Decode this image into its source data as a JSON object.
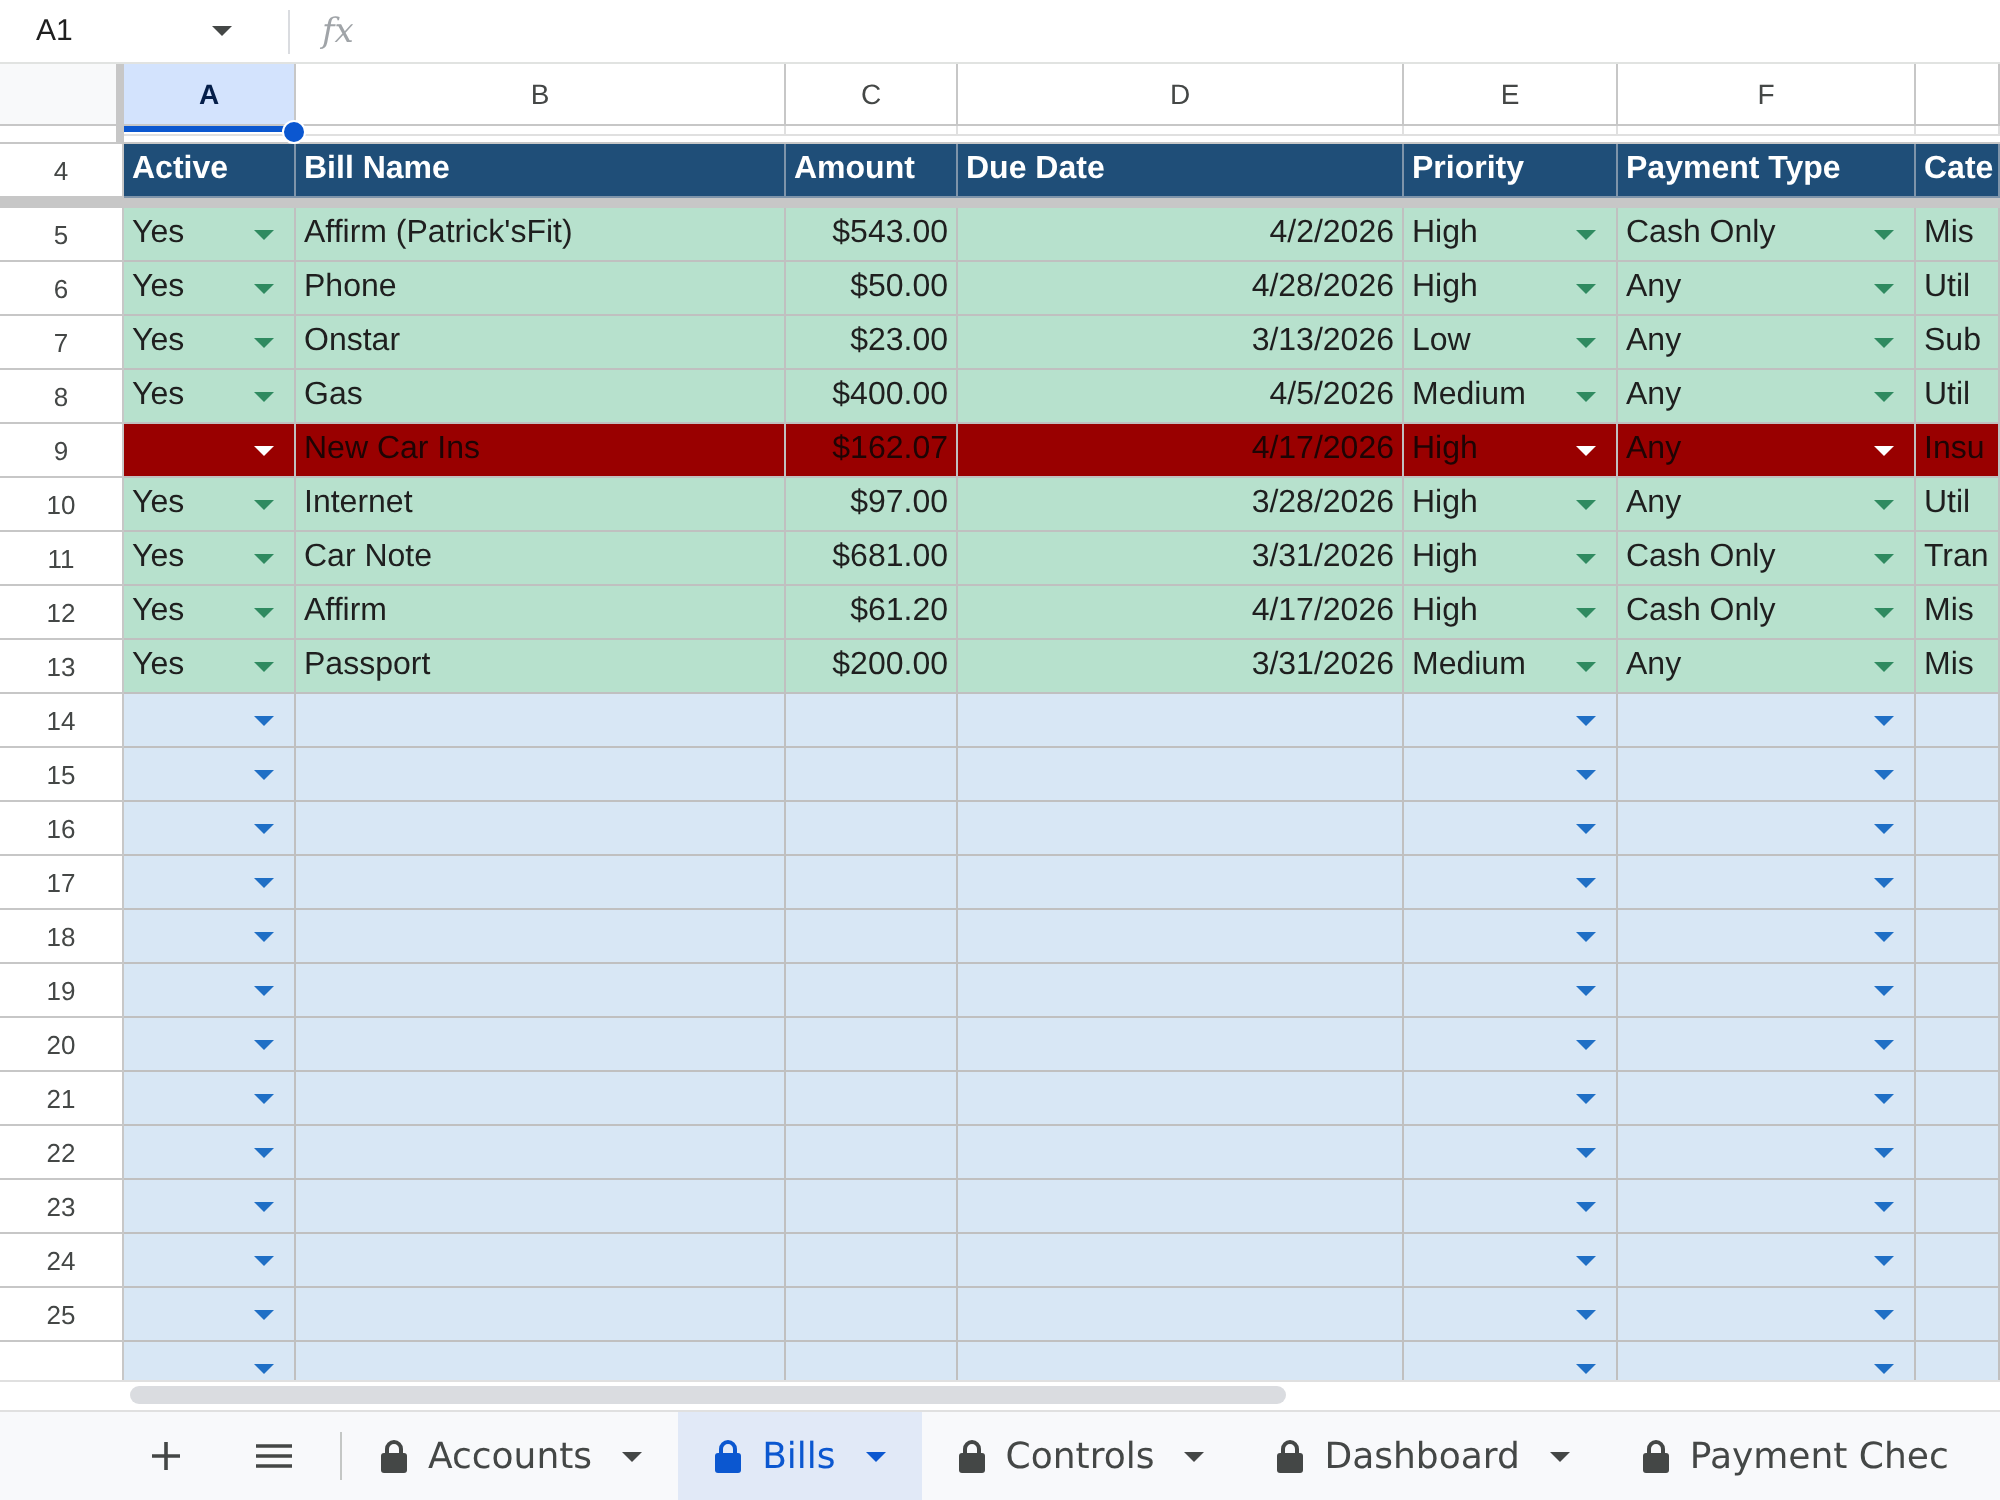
{
  "formula_bar": {
    "name_box": "A1",
    "function_label": "fx"
  },
  "table": {
    "columns": [
      {
        "letter": "A",
        "selected": true,
        "kind": "choice",
        "heading": "Active"
      },
      {
        "letter": "B",
        "selected": false,
        "kind": "text",
        "heading": "Bill Name"
      },
      {
        "letter": "C",
        "selected": false,
        "kind": "number",
        "heading": "Amount"
      },
      {
        "letter": "D",
        "selected": false,
        "kind": "number",
        "heading": "Due Date"
      },
      {
        "letter": "E",
        "selected": false,
        "kind": "choice",
        "heading": "Priority"
      },
      {
        "letter": "F",
        "selected": false,
        "kind": "choice",
        "heading": "Payment Type"
      },
      {
        "selected": false,
        "kind": "text",
        "heading": "Cate"
      }
    ],
    "heading_row_number": "4",
    "rows": [
      {
        "number": "5",
        "kind": "active",
        "cells": [
          "Yes",
          "Affirm (Patrick'sFit)",
          "$543.00",
          "4/2/2026",
          "High",
          "Cash Only",
          "Mis"
        ]
      },
      {
        "number": "6",
        "kind": "active",
        "cells": [
          "Yes",
          "Phone",
          "$50.00",
          "4/28/2026",
          "High",
          "Any",
          "Util"
        ]
      },
      {
        "number": "7",
        "kind": "active",
        "cells": [
          "Yes",
          "Onstar",
          "$23.00",
          "3/13/2026",
          "Low",
          "Any",
          "Sub"
        ]
      },
      {
        "number": "8",
        "kind": "active",
        "cells": [
          "Yes",
          "Gas",
          "$400.00",
          "4/5/2026",
          "Medium",
          "Any",
          "Util"
        ]
      },
      {
        "number": "9",
        "kind": "flagged",
        "cells": [
          null,
          "New Car Ins",
          "$162.07",
          "4/17/2026",
          "High",
          "Any",
          "Insu"
        ]
      },
      {
        "number": "10",
        "kind": "active",
        "cells": [
          "Yes",
          "Internet",
          "$97.00",
          "3/28/2026",
          "High",
          "Any",
          "Util"
        ]
      },
      {
        "number": "11",
        "kind": "active",
        "cells": [
          "Yes",
          "Car Note",
          "$681.00",
          "3/31/2026",
          "High",
          "Cash Only",
          "Tran"
        ]
      },
      {
        "number": "12",
        "kind": "active",
        "cells": [
          "Yes",
          "Affirm",
          "$61.20",
          "4/17/2026",
          "High",
          "Cash Only",
          "Mis"
        ]
      },
      {
        "number": "13",
        "kind": "active",
        "cells": [
          "Yes",
          "Passport",
          "$200.00",
          "3/31/2026",
          "Medium",
          "Any",
          "Mis"
        ]
      },
      {
        "number": "14",
        "kind": "blank"
      },
      {
        "number": "15",
        "kind": "blank"
      },
      {
        "number": "16",
        "kind": "blank"
      },
      {
        "number": "17",
        "kind": "blank"
      },
      {
        "number": "18",
        "kind": "blank"
      },
      {
        "number": "19",
        "kind": "blank"
      },
      {
        "number": "20",
        "kind": "blank"
      },
      {
        "number": "21",
        "kind": "blank"
      },
      {
        "number": "22",
        "kind": "blank"
      },
      {
        "number": "23",
        "kind": "blank"
      },
      {
        "number": "24",
        "kind": "blank"
      },
      {
        "number": "25",
        "kind": "blank"
      },
      {
        "kind": "blank"
      }
    ]
  },
  "sheet_tabs": [
    {
      "label": "Accounts",
      "selected": false,
      "locked": true,
      "menu": true
    },
    {
      "label": "Bills",
      "selected": true,
      "locked": true,
      "menu": true
    },
    {
      "label": "Controls",
      "selected": false,
      "locked": true,
      "menu": true
    },
    {
      "label": "Dashboard",
      "selected": false,
      "locked": true,
      "menu": true
    },
    {
      "label": "Payment Chec",
      "selected": false,
      "locked": true,
      "menu": false
    }
  ]
}
